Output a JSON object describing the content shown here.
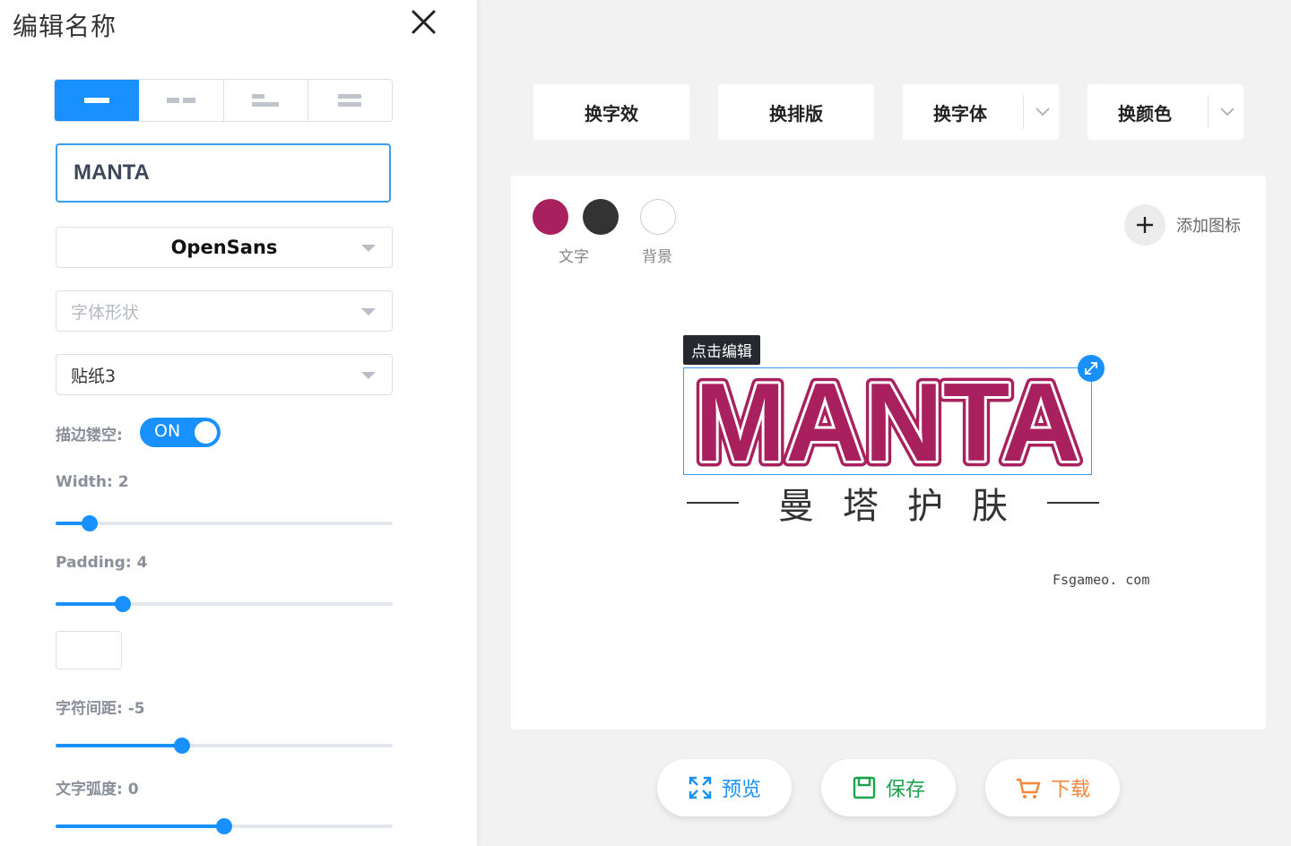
{
  "panel": {
    "title": "编辑名称",
    "name_value": "MANTA",
    "font_select": "OpenSans",
    "font_shape_placeholder": "字体形状",
    "sticker_select": "贴纸3",
    "outline_label": "描边镂空:",
    "outline_toggle": "ON",
    "width_label": "Width:",
    "width_value": "2",
    "padding_label": "Padding:",
    "padding_value": "4",
    "spacing_label": "字符间距:",
    "spacing_value": "-5",
    "arc_label": "文字弧度:",
    "arc_value": "0",
    "sliders": {
      "width": 0.1,
      "padding": 0.2,
      "spacing": 0.375,
      "arc": 0.5
    }
  },
  "toolbar": {
    "change_effect": "换字效",
    "change_layout": "换排版",
    "change_font": "换字体",
    "change_color": "换颜色"
  },
  "canvas": {
    "text_color_label": "文字",
    "bg_color_label": "背景",
    "add_icon_label": "添加图标",
    "edit_tag": "点击编辑",
    "logo_text": "MANTA",
    "subtitle": "曼塔护肤",
    "website": "Fsgameo. com",
    "colors": {
      "text_primary": "#a8205e",
      "text_secondary": "#333333",
      "background": "#ffffff"
    }
  },
  "actions": {
    "preview": "预览",
    "save": "保存",
    "download": "下载",
    "colors": {
      "preview": "#1890ff",
      "save": "#1aa34a",
      "download": "#f5863a"
    }
  }
}
